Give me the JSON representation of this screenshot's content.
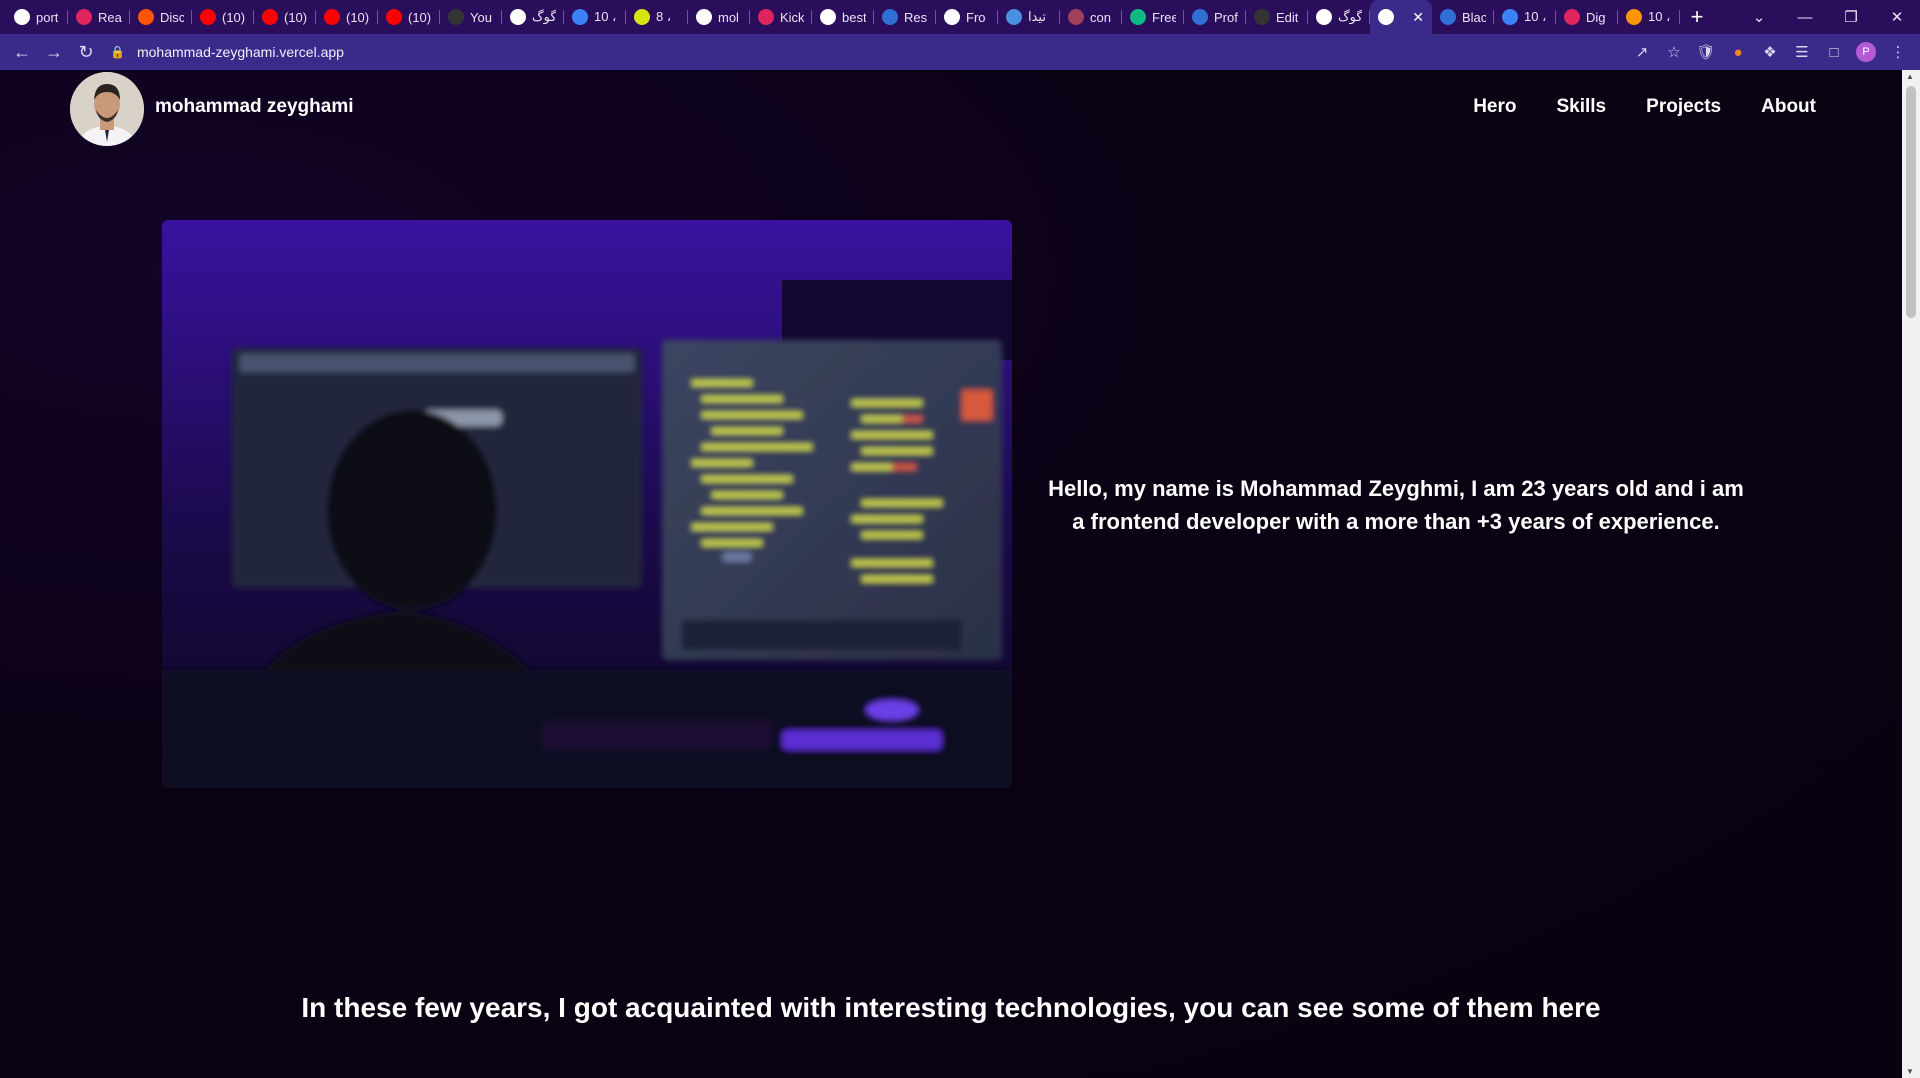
{
  "browser": {
    "tabs": [
      {
        "title": "port",
        "icon": "vercel-icon",
        "color": "#ffffff"
      },
      {
        "title": "Rea",
        "icon": "react-icon",
        "color": "#e0245e"
      },
      {
        "title": "Disc",
        "icon": "soundcloud-icon",
        "color": "#ff5500"
      },
      {
        "title": "(10)",
        "icon": "youtube-icon",
        "color": "#ff0000"
      },
      {
        "title": "(10)",
        "icon": "youtube-icon",
        "color": "#ff0000"
      },
      {
        "title": "(10)",
        "icon": "youtube-icon",
        "color": "#ff0000"
      },
      {
        "title": "(10)",
        "icon": "youtube-icon",
        "color": "#ff0000"
      },
      {
        "title": "You",
        "icon": "github-icon",
        "color": "#333333"
      },
      {
        "title": "گوگ",
        "icon": "google-icon",
        "color": "#ffffff"
      },
      {
        "title": "10 ،",
        "icon": "cloud-icon",
        "color": "#3b82f6"
      },
      {
        "title": "8 ،",
        "icon": "gauge-icon",
        "color": "#d4e60c"
      },
      {
        "title": "mol",
        "icon": "vercel-icon",
        "color": "#ffffff"
      },
      {
        "title": "Kick",
        "icon": "kick-icon",
        "color": "#e0245e"
      },
      {
        "title": "best",
        "icon": "google-icon",
        "color": "#ffffff"
      },
      {
        "title": "Res",
        "icon": "devices-icon",
        "color": "#2f6fd6"
      },
      {
        "title": "Fro",
        "icon": "chrome-icon",
        "color": "#ffffff"
      },
      {
        "title": "تیدا",
        "icon": "b-icon",
        "color": "#4a90e2"
      },
      {
        "title": "con",
        "icon": "grid-icon",
        "color": "#a0405a"
      },
      {
        "title": "Free",
        "icon": "infinity-icon",
        "color": "#10b981"
      },
      {
        "title": "Prof",
        "icon": "devices-icon",
        "color": "#2f6fd6"
      },
      {
        "title": "Edit",
        "icon": "github-icon",
        "color": "#333333"
      },
      {
        "title": "گوگ",
        "icon": "google-icon",
        "color": "#ffffff"
      },
      {
        "title": "",
        "icon": "vercel-icon",
        "color": "#ffffff",
        "active": true
      },
      {
        "title": "Blac",
        "icon": "c-icon",
        "color": "#2f6fd6"
      },
      {
        "title": "10 ،",
        "icon": "cloud-icon",
        "color": "#3b82f6"
      },
      {
        "title": "Dig",
        "icon": "d-icon",
        "color": "#e0245e"
      },
      {
        "title": "10 ،",
        "icon": "firefox-icon",
        "color": "#ff9500"
      }
    ],
    "url": "mohammad-zeyghami.vercel.app",
    "profile_initial": "P"
  },
  "header": {
    "brand": "mohammad zeyghami",
    "nav": [
      "Hero",
      "Skills",
      "Projects",
      "About"
    ]
  },
  "hero": {
    "intro": "Hello, my name is Mohammad Zeyghmi, I am 23 years old and i am a frontend developer with a more than +3 years of experience."
  },
  "skills": {
    "title": "In these few years, I got acquainted with interesting technologies, you can see some of them here"
  }
}
